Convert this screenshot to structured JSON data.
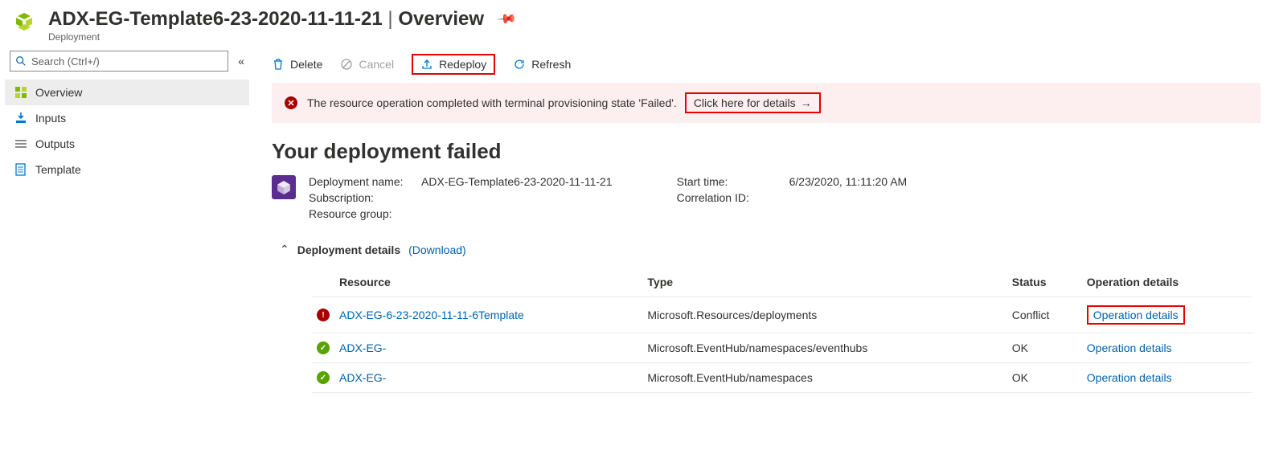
{
  "header": {
    "title_name": "ADX-EG-Template6-23-2020-11-11-21",
    "title_suffix": "Overview",
    "subtitle": "Deployment"
  },
  "search": {
    "placeholder": "Search (Ctrl+/)"
  },
  "nav": {
    "items": [
      {
        "label": "Overview",
        "active": true,
        "icon": "overview"
      },
      {
        "label": "Inputs",
        "active": false,
        "icon": "inputs"
      },
      {
        "label": "Outputs",
        "active": false,
        "icon": "outputs"
      },
      {
        "label": "Template",
        "active": false,
        "icon": "template"
      }
    ]
  },
  "toolbar": {
    "delete": "Delete",
    "cancel": "Cancel",
    "redeploy": "Redeploy",
    "refresh": "Refresh"
  },
  "alert": {
    "message": "The resource operation completed with terminal provisioning state 'Failed'.",
    "link": "Click here for details"
  },
  "fail_heading": "Your deployment failed",
  "summary": {
    "left": {
      "deployment_name_label": "Deployment name:",
      "deployment_name_value": "ADX-EG-Template6-23-2020-11-11-21",
      "subscription_label": "Subscription:",
      "subscription_value": "",
      "resource_group_label": "Resource group:",
      "resource_group_value": ""
    },
    "right": {
      "start_time_label": "Start time:",
      "start_time_value": "6/23/2020, 11:11:20 AM",
      "correlation_label": "Correlation ID:",
      "correlation_value": ""
    }
  },
  "details": {
    "title": "Deployment details",
    "download": "(Download)"
  },
  "table": {
    "headers": {
      "resource": "Resource",
      "type": "Type",
      "status": "Status",
      "opdetails": "Operation details"
    },
    "rows": [
      {
        "status_kind": "error",
        "resource": "ADX-EG-6-23-2020-11-11-6Template",
        "type": "Microsoft.Resources/deployments",
        "status": "Conflict",
        "op": "Operation details",
        "highlight": true
      },
      {
        "status_kind": "ok",
        "resource": "ADX-EG-",
        "type": "Microsoft.EventHub/namespaces/eventhubs",
        "status": "OK",
        "op": "Operation details",
        "highlight": false
      },
      {
        "status_kind": "ok",
        "resource": "ADX-EG-",
        "type": "Microsoft.EventHub/namespaces",
        "status": "OK",
        "op": "Operation details",
        "highlight": false
      }
    ]
  }
}
